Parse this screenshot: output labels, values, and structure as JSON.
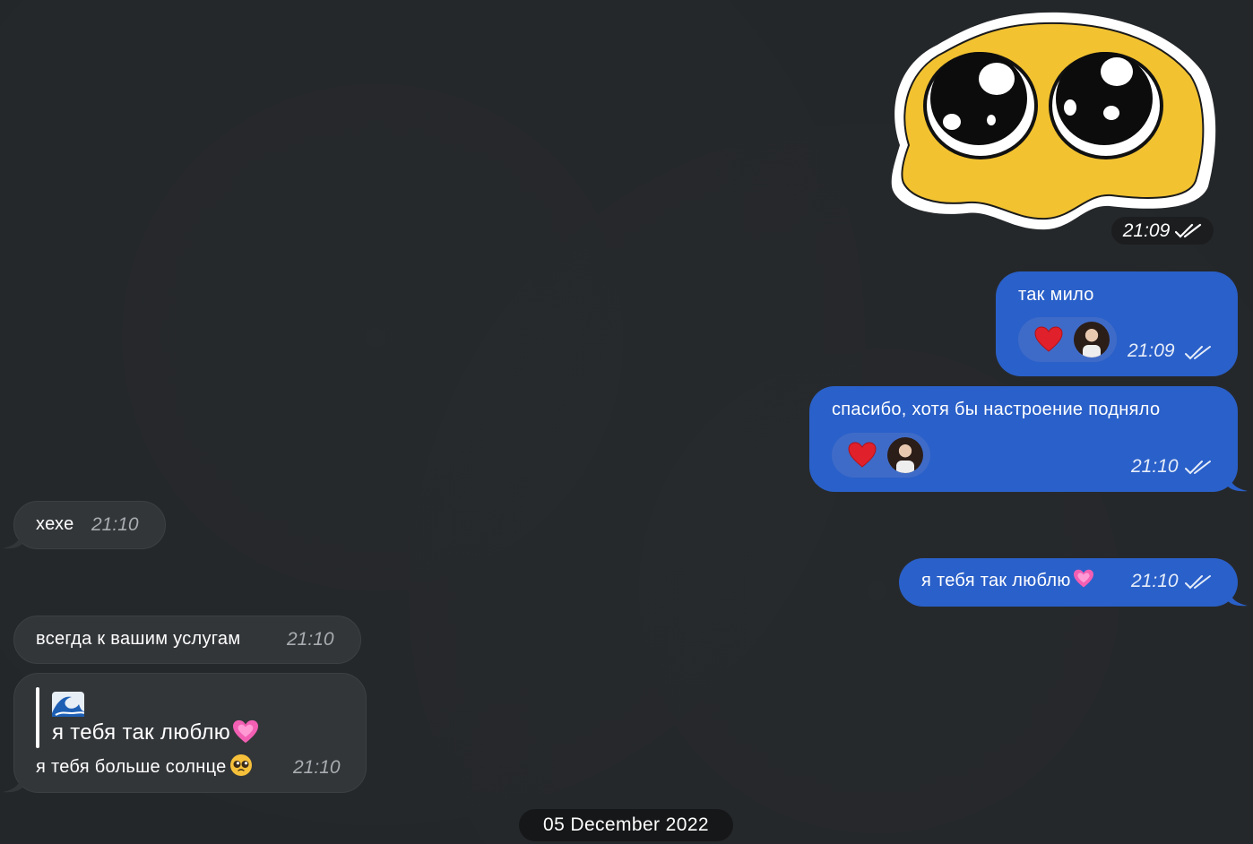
{
  "colors": {
    "background": "#24272a",
    "outgoing_bubble": "#2a60c9",
    "incoming_bubble": "#333639",
    "reaction_chip": "#3f6bc8"
  },
  "sticker": {
    "icon": "pleading-face-sticker",
    "time": "21:09"
  },
  "messages": [
    {
      "direction": "outgoing",
      "text": "так мило",
      "time": "21:09",
      "reaction": "red-heart-icon",
      "status": "read"
    },
    {
      "direction": "outgoing",
      "text": "спасибо, хотя бы настроение подняло",
      "time": "21:10",
      "reaction": "red-heart-icon",
      "status": "read"
    },
    {
      "direction": "incoming",
      "text": "хехе",
      "time": "21:10"
    },
    {
      "direction": "outgoing",
      "text": "я тебя так люблю",
      "time": "21:10",
      "status": "read"
    },
    {
      "direction": "incoming",
      "text": "всегда к вашим услугам",
      "time": "21:10"
    },
    {
      "direction": "incoming",
      "quote_text": "я тебя так люблю",
      "text": "я тебя больше солнце",
      "time": "21:10"
    }
  ],
  "date_separator": "05 December 2022"
}
